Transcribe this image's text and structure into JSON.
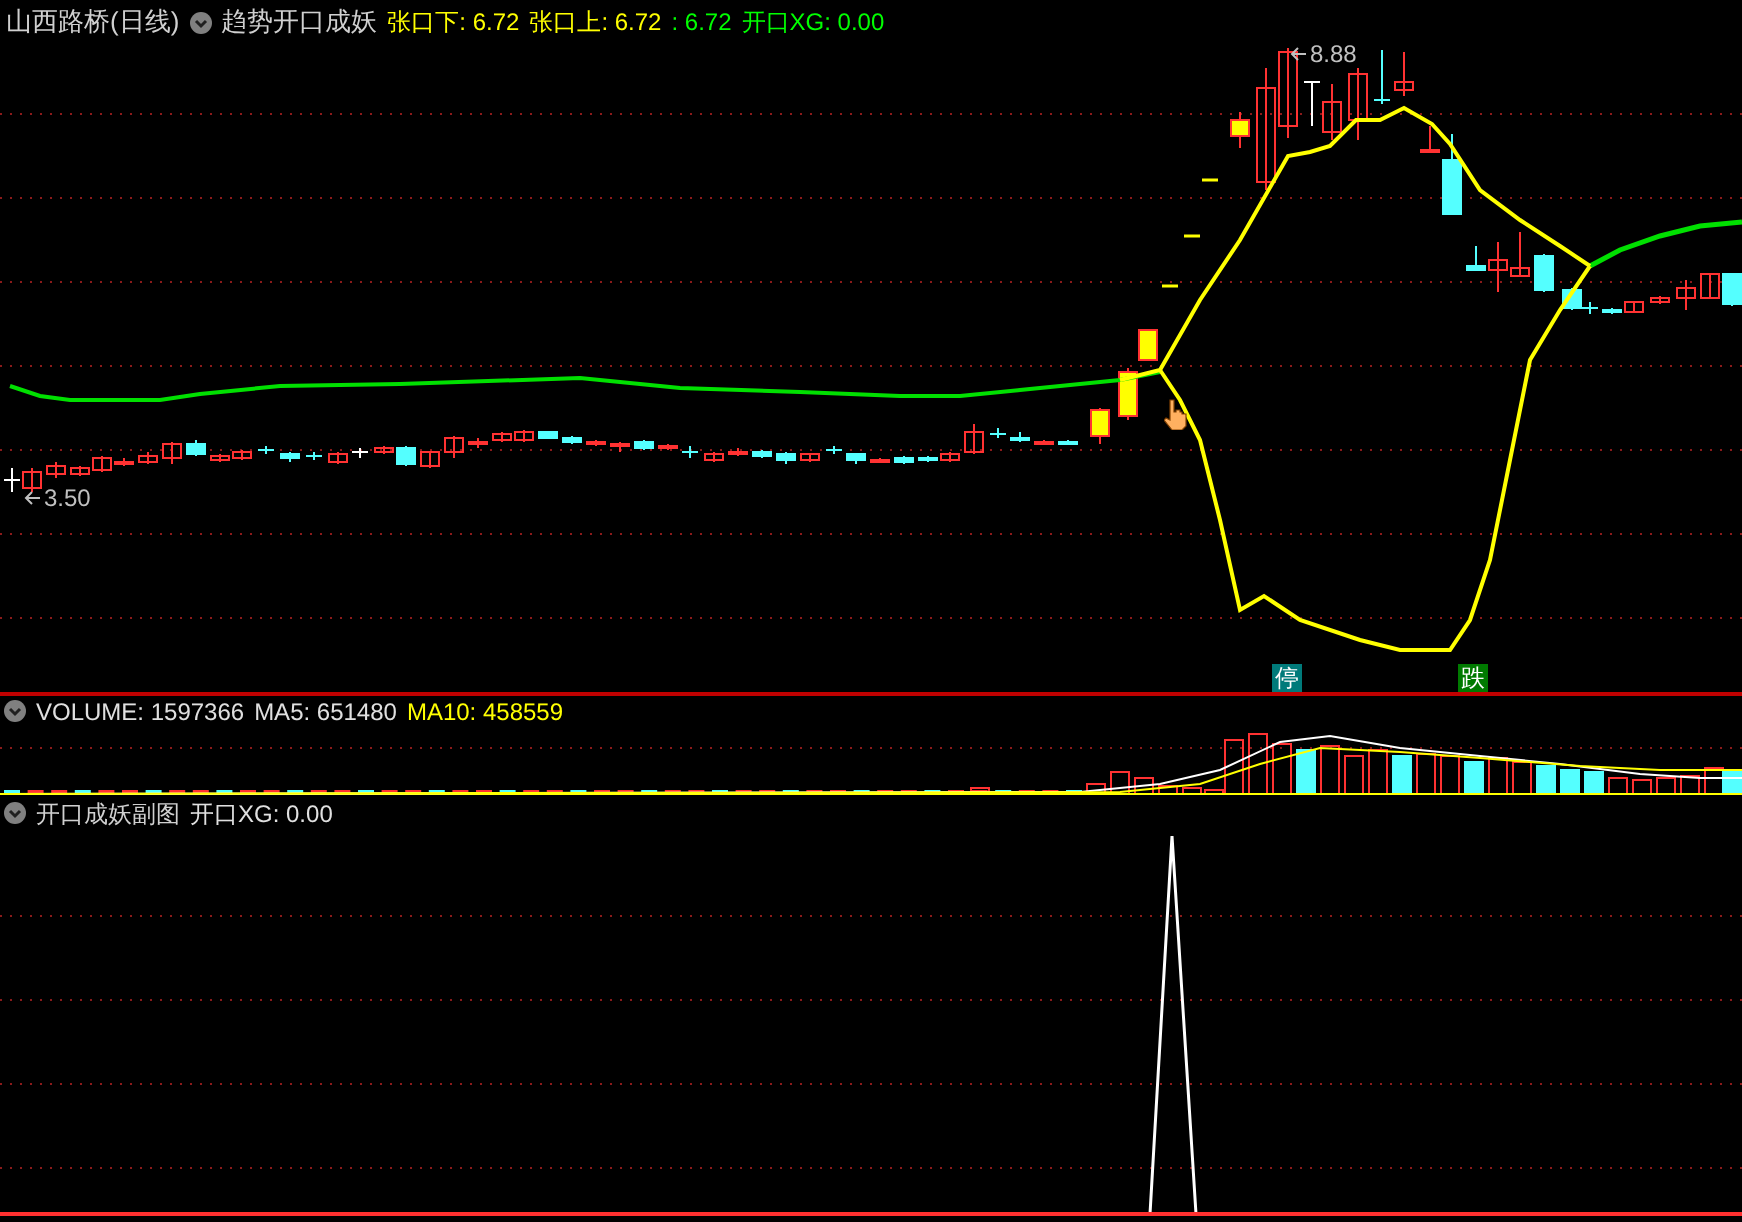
{
  "header": {
    "title": "山西路桥(日线)",
    "indicator": "趋势开口成妖",
    "values": [
      {
        "label": "张口下: 6.72",
        "color": "#ffff00"
      },
      {
        "label": "张口上: 6.72",
        "color": "#ffff00"
      },
      {
        "label": ": 6.72",
        "color": "#00ff00"
      },
      {
        "label": "开口XG: 0.00",
        "color": "#00ff00"
      }
    ]
  },
  "main_chart": {
    "high_label": "8.88",
    "low_label": "3.50",
    "signals": [
      {
        "text": "停",
        "kind": "halt"
      },
      {
        "text": "跌",
        "kind": "drop"
      }
    ]
  },
  "volume_panel": {
    "values": [
      {
        "label": "VOLUME: 1597366",
        "color": "#e0e0e0"
      },
      {
        "label": "MA5: 651480",
        "color": "#e0e0e0"
      },
      {
        "label": "MA10: 458559",
        "color": "#ffff00"
      }
    ]
  },
  "sub_panel": {
    "title": "开口成妖副图",
    "values": [
      {
        "label": "开口XG: 0.00",
        "color": "#e0e0e0"
      }
    ]
  }
}
